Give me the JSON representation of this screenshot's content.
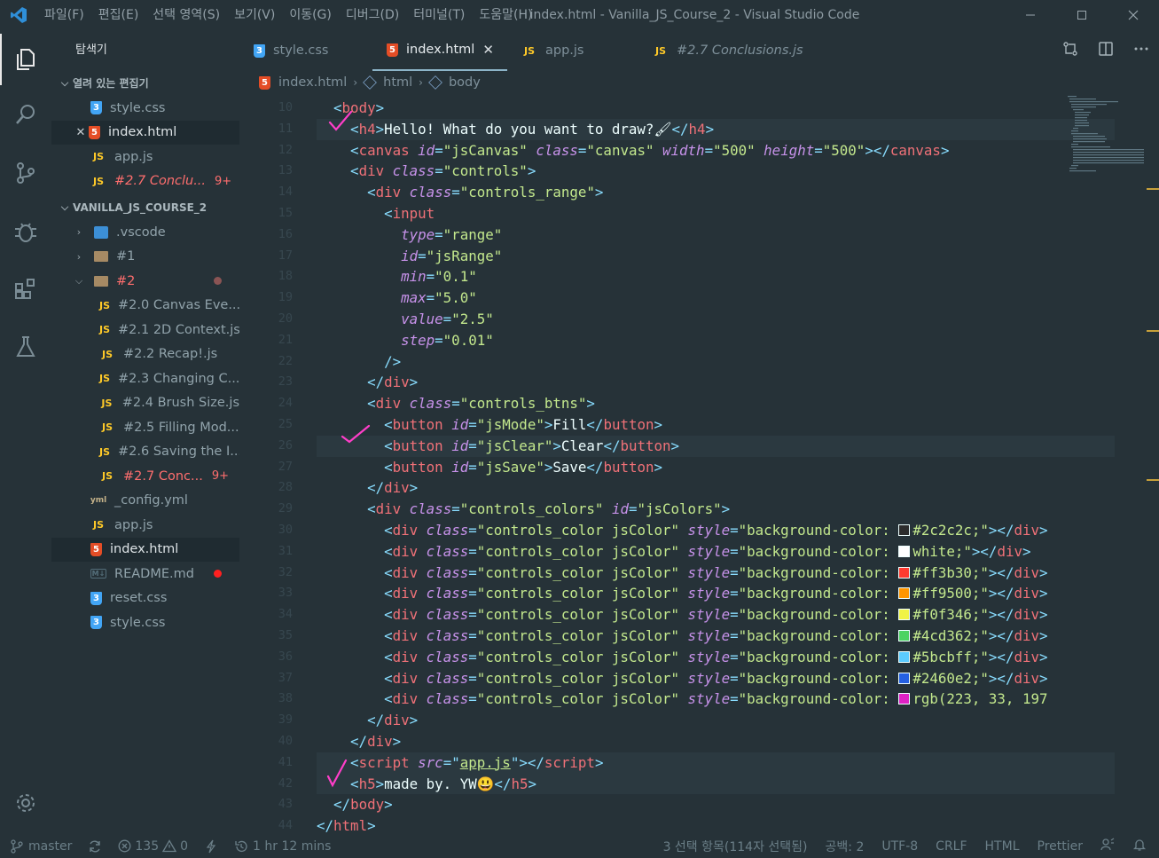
{
  "window": {
    "title": "index.html - Vanilla_JS_Course_2 - Visual Studio Code",
    "menu": [
      "파일(F)",
      "편집(E)",
      "선택 영역(S)",
      "보기(V)",
      "이동(G)",
      "디버그(D)",
      "터미널(T)",
      "도움말(H)"
    ]
  },
  "sidebar": {
    "title": "탐색기",
    "open_editors_header": "열려 있는 편집기",
    "open_editors": [
      {
        "name": "style.css",
        "icon": "css"
      },
      {
        "name": "index.html",
        "icon": "html"
      },
      {
        "name": "app.js",
        "icon": "js"
      },
      {
        "name": "#2.7 Conclu...",
        "icon": "js",
        "badge": "9+"
      }
    ],
    "project_header": "VANILLA_JS_COURSE_2",
    "tree": [
      {
        "name": ".vscode",
        "icon": "vscode"
      },
      {
        "name": "#1",
        "icon": "folder"
      },
      {
        "name": "#2",
        "icon": "folder"
      },
      {
        "name": "#2.0 Canvas Eve...",
        "icon": "js"
      },
      {
        "name": "#2.1 2D Context.js",
        "icon": "js"
      },
      {
        "name": "#2.2 Recap!.js",
        "icon": "js"
      },
      {
        "name": "#2.3 Changing C...",
        "icon": "js"
      },
      {
        "name": "#2.4 Brush Size.js",
        "icon": "js"
      },
      {
        "name": "#2.5 Filling Mod...",
        "icon": "js"
      },
      {
        "name": "#2.6 Saving the I...",
        "icon": "js"
      },
      {
        "name": "#2.7 Conc...",
        "icon": "js",
        "badge": "9+"
      },
      {
        "name": "_config.yml",
        "icon": "yml"
      },
      {
        "name": "app.js",
        "icon": "js"
      },
      {
        "name": "index.html",
        "icon": "html"
      },
      {
        "name": "README.md",
        "icon": "md"
      },
      {
        "name": "reset.css",
        "icon": "css"
      },
      {
        "name": "style.css",
        "icon": "css"
      }
    ]
  },
  "tabs": [
    {
      "label": "style.css",
      "icon": "css"
    },
    {
      "label": "index.html",
      "icon": "html",
      "close": "✕"
    },
    {
      "label": "app.js",
      "icon": "js"
    },
    {
      "label": "#2.7 Conclusions.js",
      "icon": "js"
    }
  ],
  "breadcrumb": [
    "index.html",
    "html",
    "body"
  ],
  "editor": {
    "line_numbers": [
      "10",
      "11",
      "12",
      "13",
      "14",
      "15",
      "16",
      "17",
      "18",
      "19",
      "20",
      "21",
      "22",
      "23",
      "24",
      "25",
      "26",
      "27",
      "28",
      "29",
      "30",
      "31",
      "32",
      "33",
      "34",
      "35",
      "36",
      "37",
      "38",
      "39",
      "40",
      "41",
      "42",
      "43",
      "44"
    ],
    "h4_text": "Hello! What do you want to draw?",
    "canvas_id": "\"jsCanvas\"",
    "canvas_class": "\"canvas\"",
    "canvas_width": "\"500\"",
    "canvas_height": "\"500\"",
    "controls_class": "\"controls\"",
    "range_class": "\"controls_range\"",
    "input_type": "\"range\"",
    "input_id": "\"jsRange\"",
    "input_min": "\"0.1\"",
    "input_max": "\"5.0\"",
    "input_value": "\"2.5\"",
    "input_step": "\"0.01\"",
    "btns_class": "\"controls_btns\"",
    "btn_mode_id": "\"jsMode\"",
    "btn_mode_label": "Fill",
    "btn_clear_id": "\"jsClear\"",
    "btn_clear_label": "Clear",
    "btn_save_id": "\"jsSave\"",
    "btn_save_label": "Save",
    "colors_class": "\"controls_colors\"",
    "colors_id": "\"jsColors\"",
    "color_class": "\"controls_color jsColor\"",
    "style_prefix": "\"background-color: ",
    "colors": [
      {
        "label": "#2c2c2c",
        "swatch": "#2c2c2c"
      },
      {
        "label": "white",
        "swatch": "#ffffff"
      },
      {
        "label": "#ff3b30",
        "swatch": "#ff3b30"
      },
      {
        "label": "#ff9500",
        "swatch": "#ff9500"
      },
      {
        "label": "#f0f346",
        "swatch": "#f0f346"
      },
      {
        "label": "#4cd362",
        "swatch": "#4cd362"
      },
      {
        "label": "#5bcbff",
        "swatch": "#5bcbff"
      },
      {
        "label": "#2460e2",
        "swatch": "#2460e2"
      },
      {
        "label": "rgb(223, 33, 197",
        "swatch": "#df21c5"
      }
    ],
    "script_src": "app.js",
    "h5_text": "made by. YW"
  },
  "statusbar": {
    "branch": "master",
    "errors": "135",
    "warnings": "0",
    "time": "1 hr 12 mins",
    "selection": "3 선택 항목(114자 선택됨)",
    "spaces": "공백: 2",
    "encoding": "UTF-8",
    "eol": "CRLF",
    "language": "HTML",
    "formatter": "Prettier"
  },
  "colors": {
    "background": "#263238",
    "tag": "#f07178",
    "punct": "#89ddff",
    "attr": "#c792ea",
    "string": "#c3e88d",
    "checkmark": "#ff3ec9"
  }
}
